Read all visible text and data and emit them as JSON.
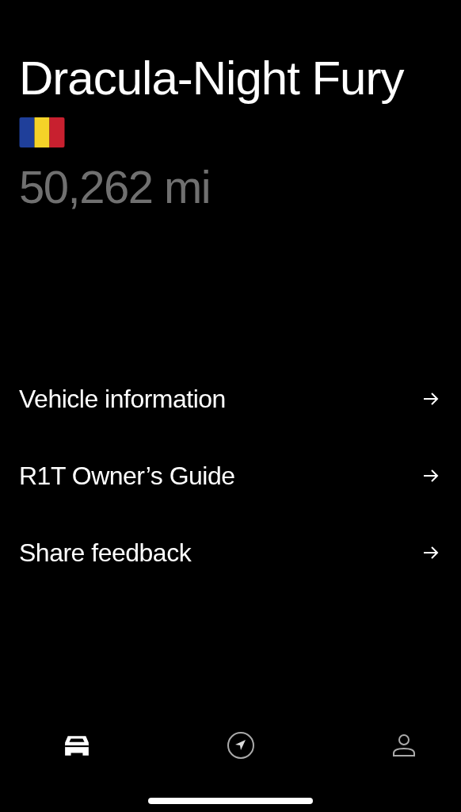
{
  "vehicle": {
    "name": "Dracula-Night Fury",
    "mileage": "50,262 mi"
  },
  "menu": [
    {
      "label": "Vehicle information"
    },
    {
      "label": "R1T Owner’s Guide"
    },
    {
      "label": "Share feedback"
    }
  ],
  "tab_bar": [
    {
      "kind": "car",
      "selected": true
    },
    {
      "kind": "navigate",
      "selected": false
    },
    {
      "kind": "profile",
      "selected": false
    }
  ]
}
